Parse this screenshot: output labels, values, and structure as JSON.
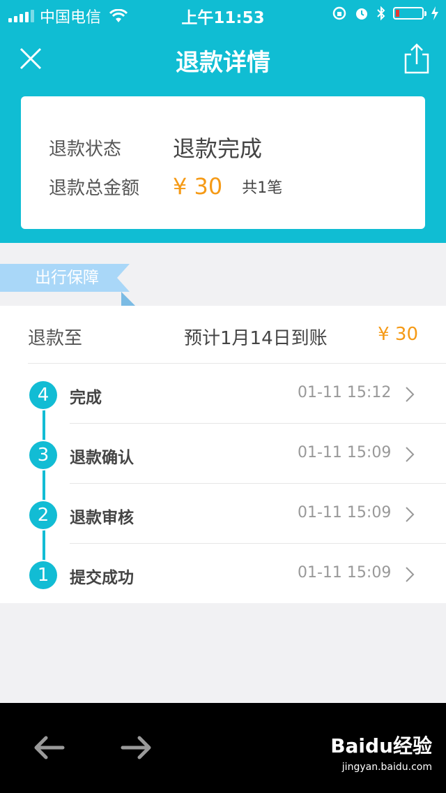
{
  "status_bar": {
    "carrier": "中国电信",
    "time": "上午11:53"
  },
  "nav": {
    "title": "退款详情",
    "close_icon": "close-icon",
    "share_icon": "share-icon"
  },
  "summary": {
    "status_label": "退款状态",
    "status_value": "退款完成",
    "total_label": "退款总金额",
    "total_amount": "¥ 30",
    "count_text": "共1笔"
  },
  "tag": {
    "label": "出行保障"
  },
  "detail": {
    "refund_to_label": "退款至",
    "eta": "预计1月14日到账",
    "amount": "¥ 30",
    "steps": [
      {
        "num": "4",
        "name": "完成",
        "time": "01-11 15:12"
      },
      {
        "num": "3",
        "name": "退款确认",
        "time": "01-11 15:09"
      },
      {
        "num": "2",
        "name": "退款审核",
        "time": "01-11 15:09"
      },
      {
        "num": "1",
        "name": "提交成功",
        "time": "01-11 15:09"
      }
    ]
  },
  "toolbar": {
    "watermark_brand": "Baidu经验",
    "watermark_url": "jingyan.baidu.com"
  },
  "colors": {
    "accent": "#10bdd3",
    "amount": "#f59a16",
    "tag": "#a9d7f8"
  }
}
